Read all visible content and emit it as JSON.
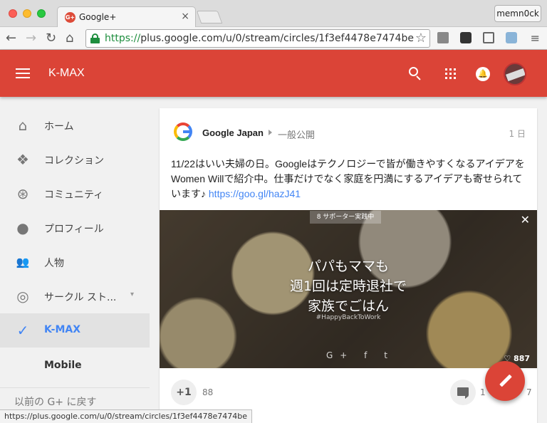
{
  "browser": {
    "tab_title": "Google+",
    "tab_favicon": "G+",
    "tab_close": "×",
    "profile_name": "memn0ck",
    "url_scheme": "https://",
    "url_rest": "plus.google.com/u/0/stream/circles/1f3ef4478e7474be",
    "status_url": "https://plus.google.com/u/0/stream/circles/1f3ef4478e7474be",
    "nav_back": "←",
    "nav_forward": "→",
    "nav_reload": "↻",
    "nav_home": "⌂",
    "star": "☆",
    "menu": "≡"
  },
  "appbar": {
    "title": "K-MAX",
    "accent_color": "#db4437"
  },
  "sidebar": {
    "items": [
      {
        "label": "ホーム",
        "icon": "home-icon",
        "glyph": "⌂"
      },
      {
        "label": "コレクション",
        "icon": "collections-icon",
        "glyph": "❖"
      },
      {
        "label": "コミュニティ",
        "icon": "communities-icon",
        "glyph": "⊛"
      },
      {
        "label": "プロフィール",
        "icon": "profile-icon",
        "glyph": "●"
      },
      {
        "label": "人物",
        "icon": "people-icon",
        "glyph": "👥"
      },
      {
        "label": "サークル スト...",
        "icon": "circles-icon",
        "glyph": "◎",
        "caret": "▾"
      },
      {
        "label": "K-MAX",
        "icon": "check-icon",
        "glyph": "✓",
        "active": true
      }
    ],
    "sub_item": "Mobile",
    "back_link": "以前の G+ に戻す"
  },
  "post": {
    "author": "Google Japan",
    "visibility": "一般公開",
    "time": "1 日",
    "text": "11/22はいい夫婦の日。Googleはテクノロジーで皆が働きやすくなるアイデアをWomen Willで紹介中。仕事だけでなく家庭を円満にするアイデアも寄せられています♪ ",
    "link": "https://goo.gl/hazJ41",
    "image": {
      "badge": "8 サポーター実践中",
      "close": "✕",
      "line1": "パパもママも",
      "line2": "週1回は定時退社で",
      "line3": "家族でごはん",
      "hashtag": "#HappyBackToWork",
      "social": "G+ f t",
      "likes": "♡ 887"
    },
    "plus_label": "+1",
    "plus_count": "88",
    "comment_count": "1",
    "share_count": "7"
  }
}
